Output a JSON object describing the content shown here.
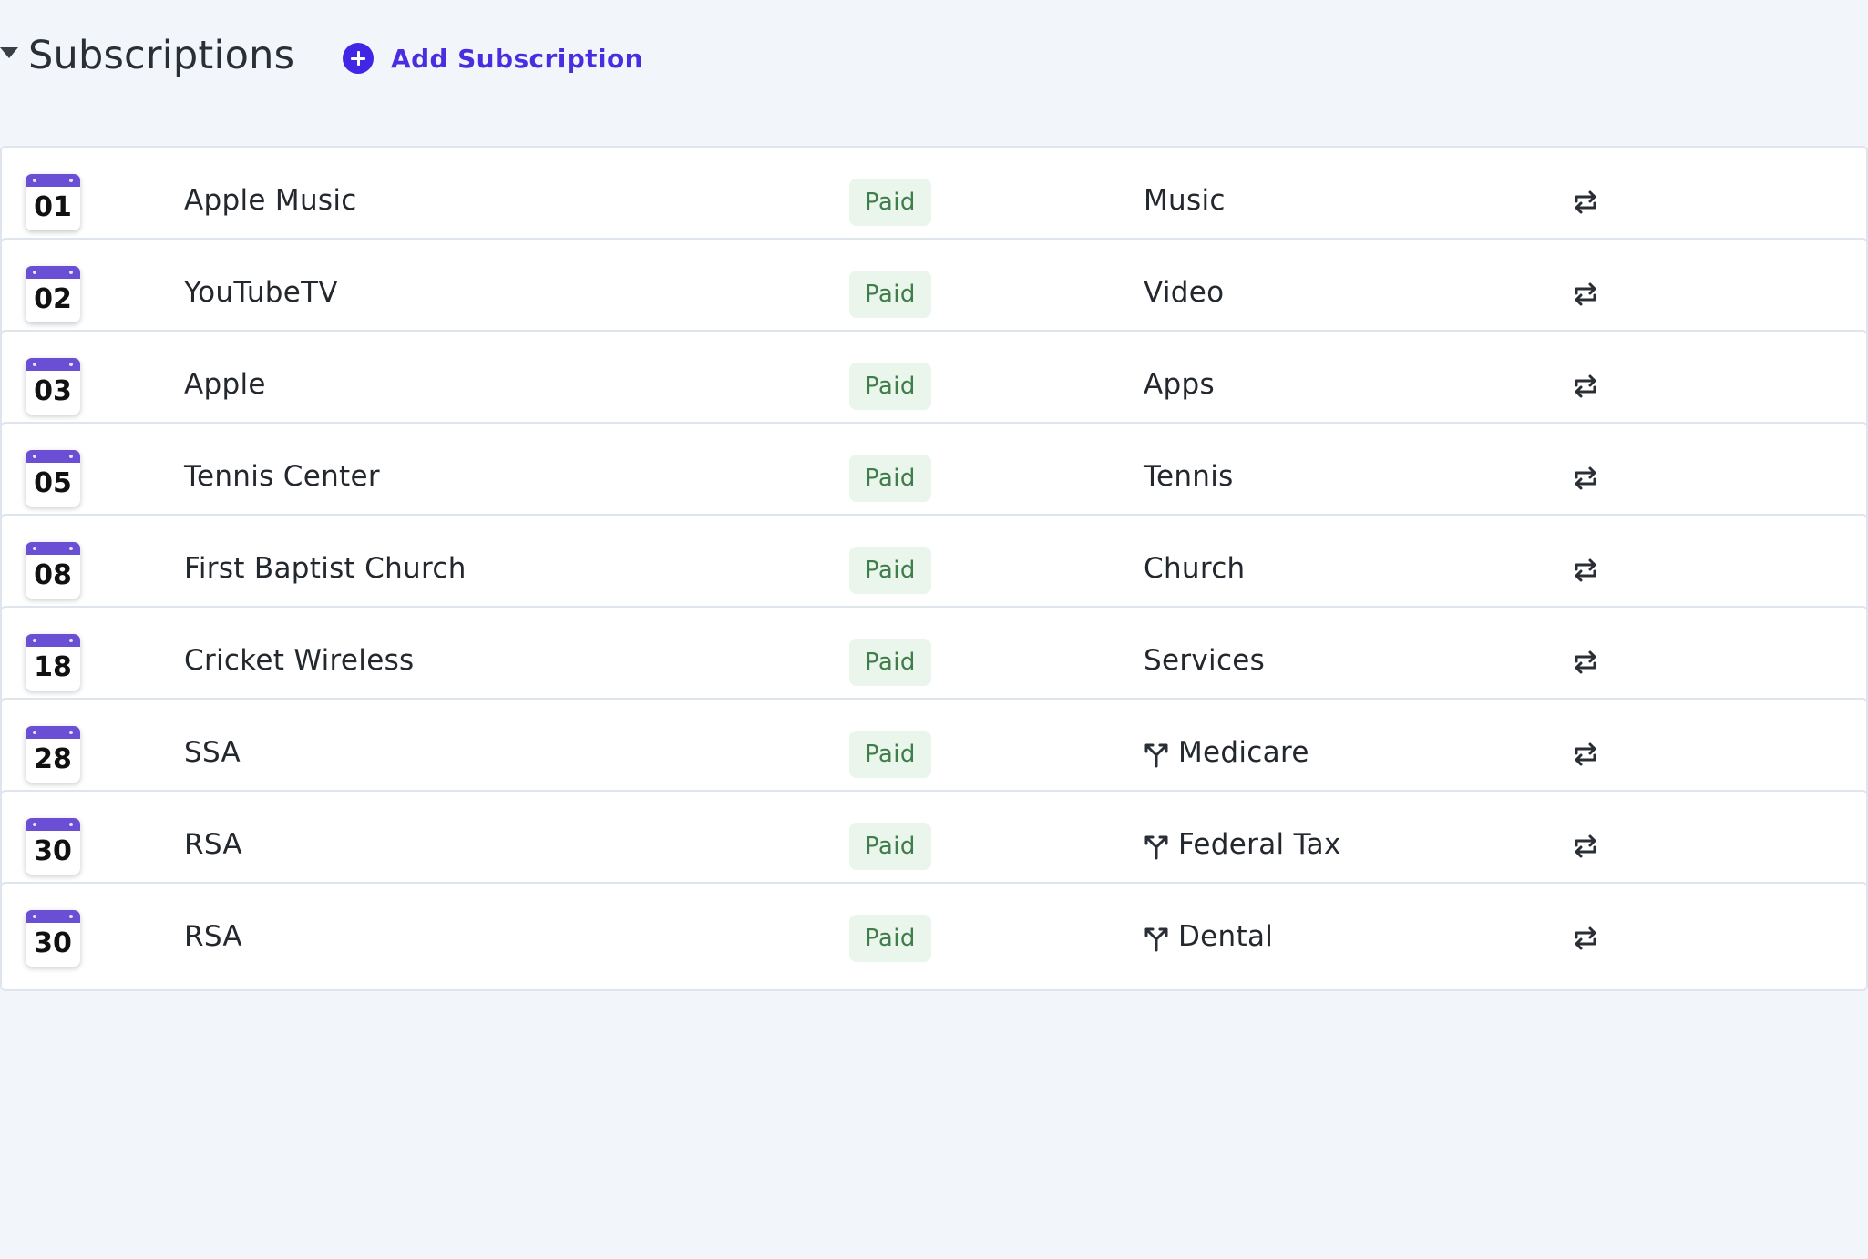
{
  "header": {
    "title": "Subscriptions",
    "add_label": "Add Subscription",
    "collapse_icon": "caret-down-icon",
    "add_icon": "plus-circle-icon"
  },
  "colors": {
    "accent": "#4226e6",
    "calendar_bar": "#6a4fd4",
    "paid_bg": "#eaf6ec",
    "paid_text": "#3f7d4b",
    "page_bg": "#f2f6fa"
  },
  "rows": [
    {
      "day": "01",
      "name": "Apple Music",
      "status": "Paid",
      "category": "Music",
      "split": false
    },
    {
      "day": "02",
      "name": "YouTubeTV",
      "status": "Paid",
      "category": "Video",
      "split": false
    },
    {
      "day": "03",
      "name": "Apple",
      "status": "Paid",
      "category": "Apps",
      "split": false
    },
    {
      "day": "05",
      "name": "Tennis Center",
      "status": "Paid",
      "category": "Tennis",
      "split": false
    },
    {
      "day": "08",
      "name": "First Baptist Church",
      "status": "Paid",
      "category": "Church",
      "split": false
    },
    {
      "day": "18",
      "name": "Cricket Wireless",
      "status": "Paid",
      "category": "Services",
      "split": false
    },
    {
      "day": "28",
      "name": "SSA",
      "status": "Paid",
      "category": "Medicare",
      "split": true
    },
    {
      "day": "30",
      "name": "RSA",
      "status": "Paid",
      "category": "Federal Tax",
      "split": true
    },
    {
      "day": "30",
      "name": "RSA",
      "status": "Paid",
      "category": "Dental",
      "split": true
    }
  ]
}
